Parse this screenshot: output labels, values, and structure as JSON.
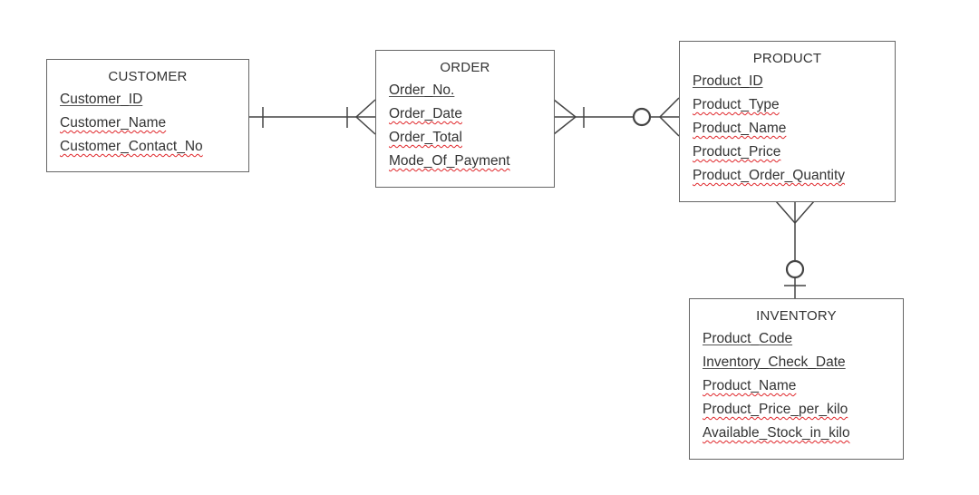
{
  "entities": {
    "customer": {
      "title": "CUSTOMER",
      "attributes": [
        {
          "name": "Customer_ID",
          "spell_flag": false
        },
        {
          "name": "Customer_Name",
          "spell_flag": true
        },
        {
          "name": "Customer_Contact_No",
          "spell_flag": true
        }
      ]
    },
    "order": {
      "title": "ORDER",
      "attributes": [
        {
          "name": "Order_No.",
          "spell_flag": false
        },
        {
          "name": "Order_Date",
          "spell_flag": true
        },
        {
          "name": "Order_Total",
          "spell_flag": true
        },
        {
          "name": "Mode_Of_Payment",
          "spell_flag": true
        }
      ]
    },
    "product": {
      "title": "PRODUCT",
      "attributes": [
        {
          "name": "Product_ID",
          "spell_flag": false
        },
        {
          "name": "Product_Type",
          "spell_flag": true
        },
        {
          "name": "Product_Name",
          "spell_flag": true
        },
        {
          "name": "Product_Price",
          "spell_flag": true
        },
        {
          "name": "Product_Order_Quantity",
          "spell_flag": true
        }
      ]
    },
    "inventory": {
      "title": "INVENTORY",
      "attributes": [
        {
          "name": "Product_Code",
          "spell_flag": false
        },
        {
          "name": "Inventory_Check_Date",
          "spell_flag": false
        },
        {
          "name": "Product_Name",
          "spell_flag": true
        },
        {
          "name": "Product_Price_per_kilo",
          "spell_flag": true
        },
        {
          "name": "Available_Stock_in_kilo",
          "spell_flag": true
        }
      ]
    }
  },
  "relationships": [
    {
      "from": "CUSTOMER",
      "to": "ORDER",
      "from_cardinality": "one-and-only-one",
      "to_cardinality": "one-or-many"
    },
    {
      "from": "ORDER",
      "to": "PRODUCT",
      "from_cardinality": "one-or-many",
      "to_cardinality": "zero-or-many"
    },
    {
      "from": "PRODUCT",
      "to": "INVENTORY",
      "from_cardinality": "many",
      "to_cardinality": "zero-or-one"
    }
  ],
  "colors": {
    "border": "#666666",
    "spellcheck_underline": "#e0262a",
    "text": "#333333"
  }
}
